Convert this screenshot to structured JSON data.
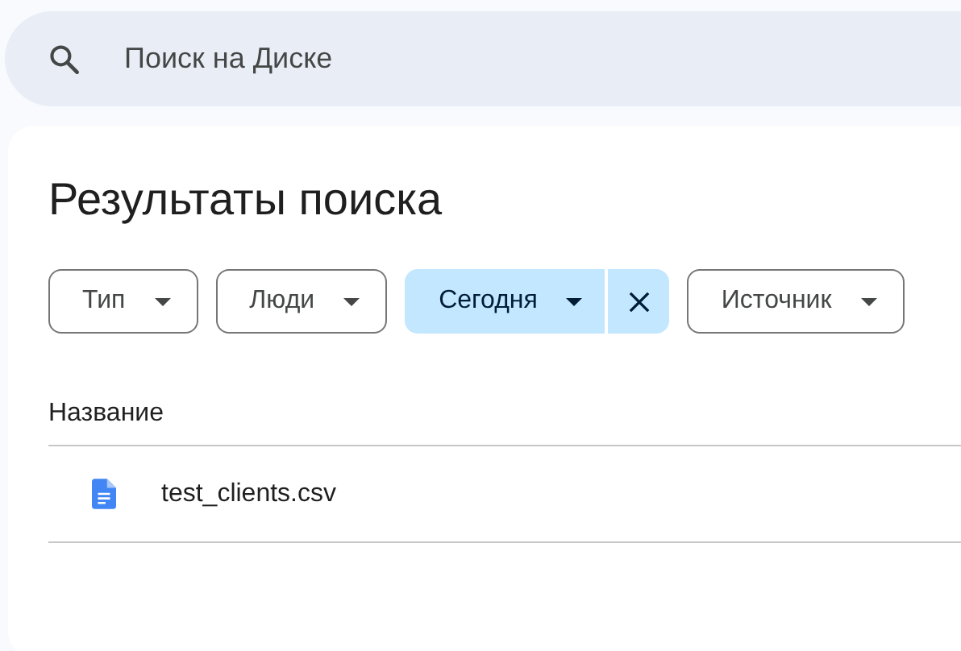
{
  "search": {
    "placeholder": "Поиск на Диске"
  },
  "title": "Результаты поиска",
  "filters": [
    {
      "label": "Тип",
      "selected": false
    },
    {
      "label": "Люди",
      "selected": false
    },
    {
      "label": "Сегодня",
      "selected": true
    },
    {
      "label": "Источник",
      "selected": false
    }
  ],
  "table": {
    "columns": [
      "Название"
    ],
    "rows": [
      {
        "name": "test_clients.csv"
      }
    ]
  }
}
